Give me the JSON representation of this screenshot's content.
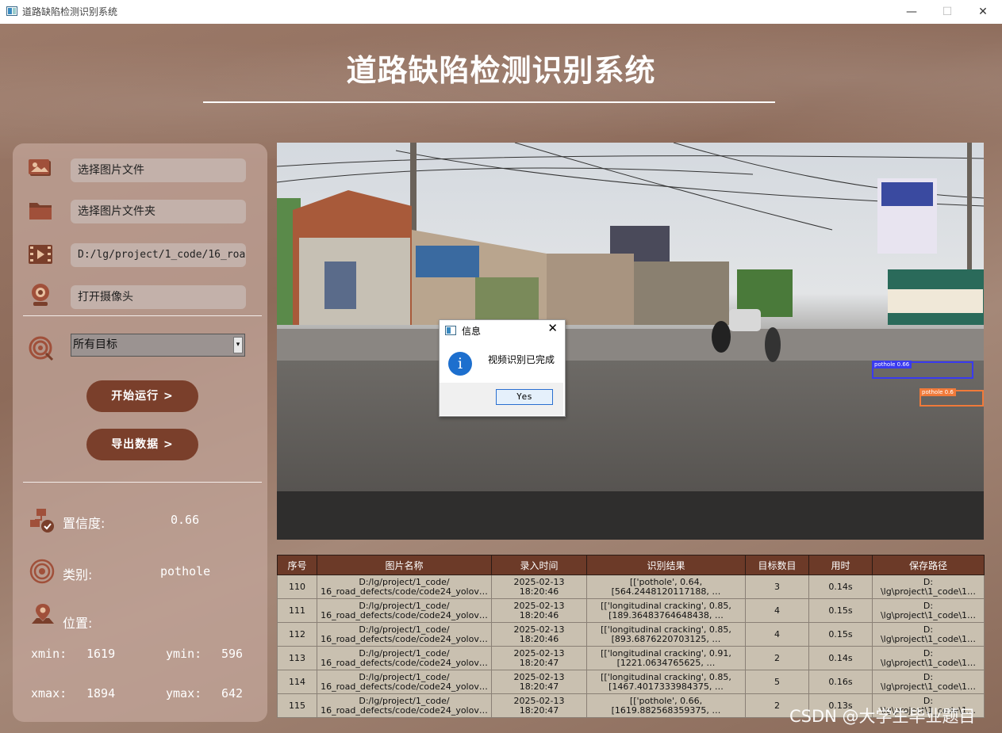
{
  "window": {
    "title": "道路缺陷检测识别系统",
    "minimize": "—",
    "maximize": "☐",
    "close": "✕"
  },
  "header": {
    "title": "道路缺陷检测识别系统"
  },
  "sidebar": {
    "select_image": "选择图片文件",
    "select_folder": "选择图片文件夹",
    "video_path": "D:/lg/project/1_code/16_road",
    "open_camera": "打开摄像头",
    "target_select": {
      "selected": "所有目标",
      "arrow": "▾"
    },
    "start_button": "开始运行 >",
    "export_button": "导出数据 >",
    "confidence_label": "置信度:",
    "confidence_value": "0.66",
    "class_label": "类别:",
    "class_value": "pothole",
    "position_label": "位置:",
    "xmin_label": "xmin:",
    "xmin_value": "1619",
    "ymin_label": "ymin:",
    "ymin_value": "596",
    "xmax_label": "xmax:",
    "xmax_value": "1894",
    "ymax_label": "ymax:",
    "ymax_value": "642"
  },
  "video": {
    "detections": [
      {
        "label": "pothole 0.66",
        "color": "#3a3af0"
      },
      {
        "label": "pothole 0.6",
        "color": "#f07a3a"
      }
    ]
  },
  "dialog": {
    "title": "信息",
    "close": "✕",
    "icon": "i",
    "message": "视频识别已完成",
    "yes": "Yes"
  },
  "table": {
    "headers": [
      "序号",
      "图片名称",
      "录入时间",
      "识别结果",
      "目标数目",
      "用时",
      "保存路径"
    ],
    "rows": [
      [
        "110",
        "D:/lg/project/1_code/\n16_road_defects/code/code24_yolov…",
        "2025-02-13\n18:20:46",
        "[['pothole', 0.64,\n[564.2448120117188, …",
        "3",
        "0.14s",
        "D:\n\\lg\\project\\1_code\\1…"
      ],
      [
        "111",
        "D:/lg/project/1_code/\n16_road_defects/code/code24_yolov…",
        "2025-02-13\n18:20:46",
        "[['longitudinal cracking', 0.85,\n[189.36483764648438, …",
        "4",
        "0.15s",
        "D:\n\\lg\\project\\1_code\\1…"
      ],
      [
        "112",
        "D:/lg/project/1_code/\n16_road_defects/code/code24_yolov…",
        "2025-02-13\n18:20:46",
        "[['longitudinal cracking', 0.85,\n[893.6876220703125, …",
        "4",
        "0.15s",
        "D:\n\\lg\\project\\1_code\\1…"
      ],
      [
        "113",
        "D:/lg/project/1_code/\n16_road_defects/code/code24_yolov…",
        "2025-02-13\n18:20:47",
        "[['longitudinal cracking', 0.91,\n[1221.0634765625, …",
        "2",
        "0.14s",
        "D:\n\\lg\\project\\1_code\\1…"
      ],
      [
        "114",
        "D:/lg/project/1_code/\n16_road_defects/code/code24_yolov…",
        "2025-02-13\n18:20:47",
        "[['longitudinal cracking', 0.85,\n[1467.4017333984375, …",
        "5",
        "0.16s",
        "D:\n\\lg\\project\\1_code\\1…"
      ],
      [
        "115",
        "D:/lg/project/1_code/\n16_road_defects/code/code24_yolov…",
        "2025-02-13\n18:20:47",
        "[['pothole', 0.66,\n[1619.882568359375, …",
        "2",
        "0.13s",
        "D:\n\\lg\\project\\1_code\\1…"
      ]
    ]
  },
  "watermark": "CSDN @大学生毕业题目"
}
